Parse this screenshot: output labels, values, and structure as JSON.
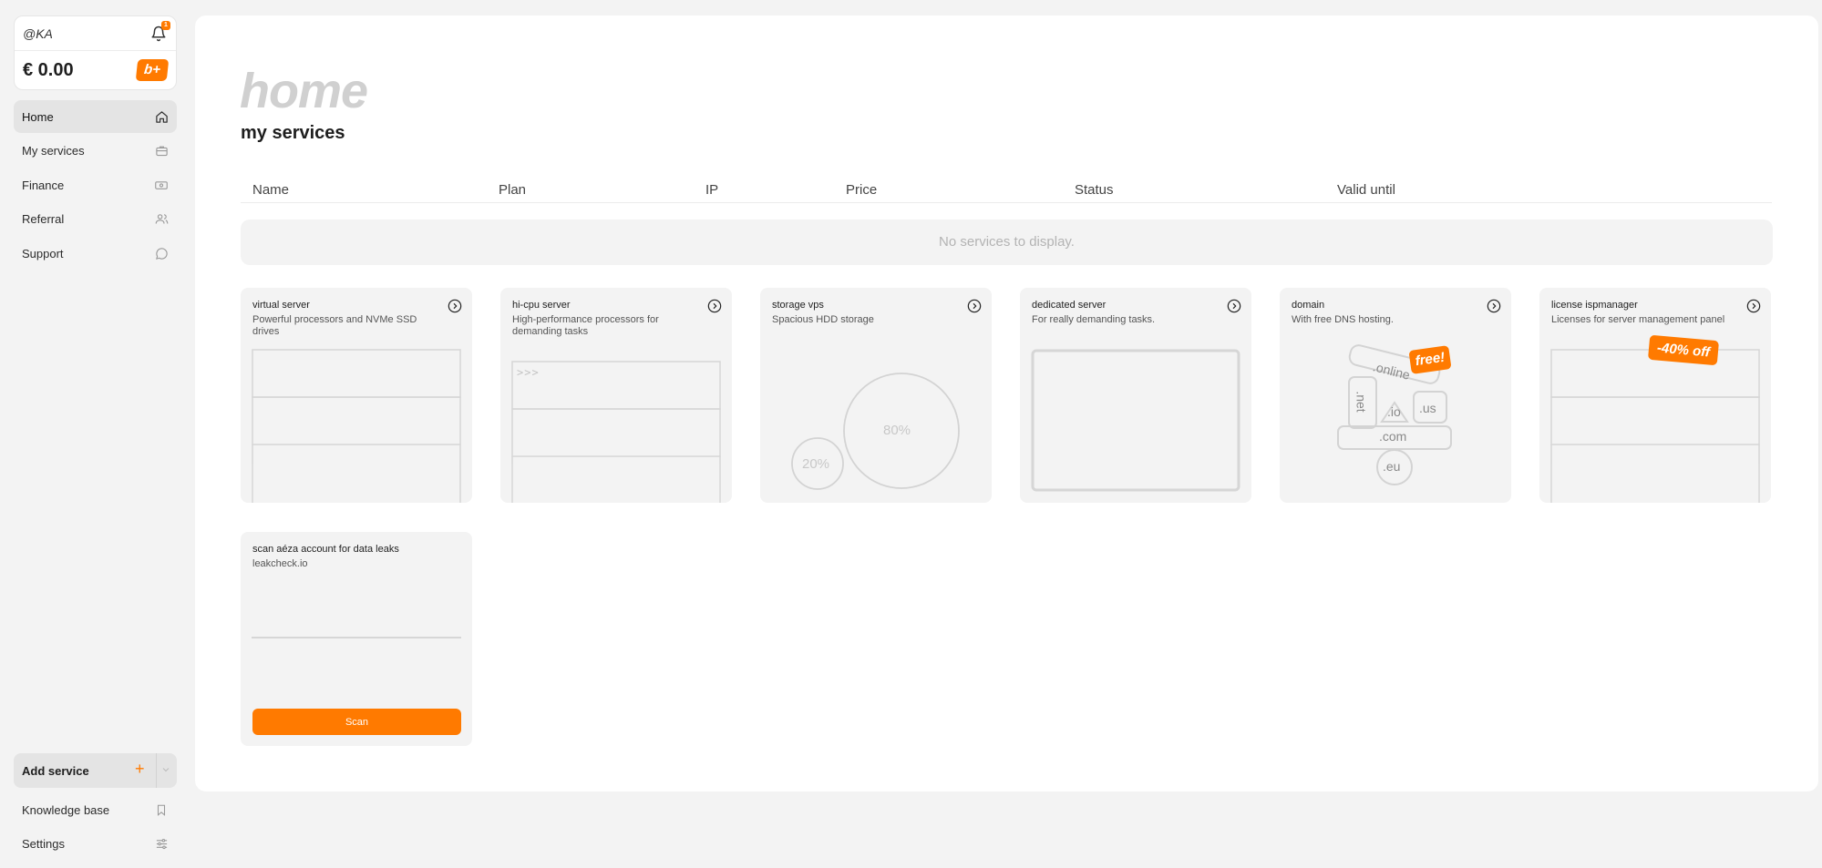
{
  "account": {
    "username": "@KA",
    "notification_count": "1",
    "balance": "€ 0.00",
    "bonus_label": "b+"
  },
  "nav": {
    "items": [
      {
        "label": "Home",
        "icon": "home-icon",
        "active": true
      },
      {
        "label": "My services",
        "icon": "briefcase-icon"
      },
      {
        "label": "Finance",
        "icon": "banknote-icon"
      },
      {
        "label": "Referral",
        "icon": "users-icon"
      },
      {
        "label": "Support",
        "icon": "chat-icon"
      }
    ],
    "add_service": "Add service",
    "bottom": [
      {
        "label": "Knowledge base",
        "icon": "bookmark-icon"
      },
      {
        "label": "Settings",
        "icon": "sliders-icon"
      }
    ]
  },
  "main": {
    "title": "home",
    "section_title": "my services",
    "columns": [
      "Name",
      "Plan",
      "IP",
      "Price",
      "Status",
      "Valid until"
    ],
    "empty_text": "No services to display."
  },
  "cards": [
    {
      "title": "virtual server",
      "desc": "Powerful processors and NVMe SSD drives"
    },
    {
      "title": "hi-cpu server",
      "desc": "High-performance processors for demanding tasks",
      "terminal_prompt": ">>>"
    },
    {
      "title": "storage vps",
      "desc": "Spacious HDD storage",
      "storage_big": "80%",
      "storage_small": "20%"
    },
    {
      "title": "dedicated server",
      "desc": "For really demanding tasks."
    },
    {
      "title": "domain",
      "desc": "With free DNS hosting.",
      "badge": "free!",
      "tlds": {
        "online": ".online",
        "net": ".net",
        "io": ".io",
        "us": ".us",
        "com": ".com",
        "eu": ".eu"
      }
    },
    {
      "title": "license ispmanager",
      "desc": "Licenses for server management panel",
      "badge": "-40% off"
    }
  ],
  "scan": {
    "title": "scan aéza account for data leaks",
    "subtitle": "leakcheck.io",
    "button": "Scan"
  },
  "colors": {
    "accent": "#ff7a00",
    "background": "#f3f3f3",
    "panel": "#ffffff"
  }
}
